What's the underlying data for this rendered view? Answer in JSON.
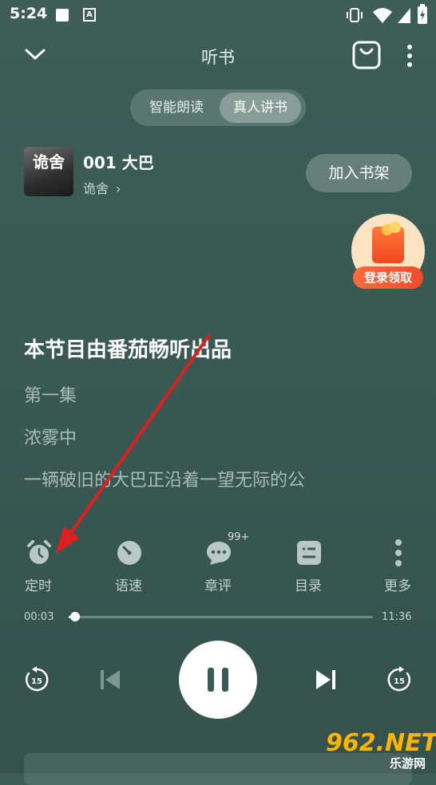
{
  "status_bar": {
    "time": "5:24",
    "letter_icon": "A"
  },
  "header": {
    "title": "听书"
  },
  "mode_tabs": [
    {
      "label": "智能朗读"
    },
    {
      "label": "真人讲书"
    }
  ],
  "book": {
    "title": "001 大巴",
    "author": "诡舍",
    "cover_text": "诡舍",
    "shelf_button": "加入书架"
  },
  "promo": {
    "label": "登录领取"
  },
  "content": {
    "heading": "本节目由番茄畅听出品",
    "lines": [
      "第一集",
      "浓雾中",
      "一辆破旧的大巴正沿着一望无际的公"
    ]
  },
  "controls": [
    {
      "label": "定时",
      "icon": "alarm-clock-icon"
    },
    {
      "label": "语速",
      "icon": "speed-gauge-icon"
    },
    {
      "label": "章评",
      "icon": "comment-icon",
      "badge": "99+"
    },
    {
      "label": "目录",
      "icon": "list-icon"
    },
    {
      "label": "更多",
      "icon": "more-vertical-icon"
    }
  ],
  "progress": {
    "current": "00:03",
    "duration": "11:36",
    "fraction": 0.004
  },
  "player": {
    "rewind_label": "15",
    "forward_label": "15"
  },
  "watermark": {
    "text": "962.NET",
    "sub": "乐游网"
  },
  "colors": {
    "background": "#3a5a54",
    "arrow": "#e01e1e",
    "promo": "#f24a29"
  }
}
